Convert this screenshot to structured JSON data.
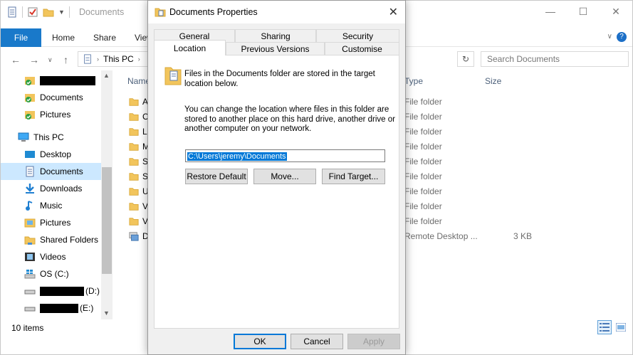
{
  "explorer": {
    "title": "Documents",
    "ribbon_tabs": {
      "file": "File",
      "home": "Home",
      "share": "Share",
      "view": "View"
    },
    "address": {
      "path": "This PC"
    },
    "search_placeholder": "Search Documents",
    "columns": {
      "name": "Name",
      "type": "Type",
      "size": "Size"
    },
    "nav": {
      "this_pc": "This PC",
      "desktop": "Desktop",
      "documents": "Documents",
      "downloads": "Downloads",
      "music": "Music",
      "pictures": "Pictures",
      "shared_folders": "Shared Folders",
      "videos": "Videos",
      "os_c": "OS (C:)",
      "quick_documents": "Documents",
      "quick_pictures": "Pictures",
      "drive_d_letter": "(D:)",
      "drive_e_letter": "(E:)"
    },
    "files": [
      {
        "initial": "A",
        "type": "File folder",
        "size": ""
      },
      {
        "initial": "C",
        "type": "File folder",
        "size": ""
      },
      {
        "initial": "LI",
        "type": "File folder",
        "size": ""
      },
      {
        "initial": "M",
        "type": "File folder",
        "size": ""
      },
      {
        "initial": "Sl",
        "type": "File folder",
        "size": ""
      },
      {
        "initial": "Sc",
        "type": "File folder",
        "size": ""
      },
      {
        "initial": "U",
        "type": "File folder",
        "size": ""
      },
      {
        "initial": "V",
        "type": "File folder",
        "size": ""
      },
      {
        "initial": "V",
        "type": "File folder",
        "size": ""
      },
      {
        "initial": "D",
        "type": "Remote Desktop ...",
        "size": "3 KB"
      }
    ],
    "status": "10 items"
  },
  "dialog": {
    "title": "Documents Properties",
    "tabs": {
      "general": "General",
      "sharing": "Sharing",
      "security": "Security",
      "location": "Location",
      "previous_versions": "Previous Versions",
      "customise": "Customise"
    },
    "info_text": "Files in the Documents folder are stored in the target location below.",
    "info_line1": "Files in the Documents folder are stored in the target",
    "info_line2": "location below.",
    "change_line1": "You can change the location where files in this folder are",
    "change_line2": "stored to another place on this hard drive, another drive or",
    "change_line3": "another computer on your network.",
    "path_value": "C:\\Users\\jeremy\\Documents",
    "buttons": {
      "restore_default": "Restore Default",
      "move": "Move...",
      "find_target": "Find Target...",
      "ok": "OK",
      "cancel": "Cancel",
      "apply": "Apply"
    }
  },
  "colors": {
    "accent": "#1979ca",
    "selection": "#0078d7",
    "nav_selected": "#cce8ff",
    "folder": "#f2c55c"
  }
}
